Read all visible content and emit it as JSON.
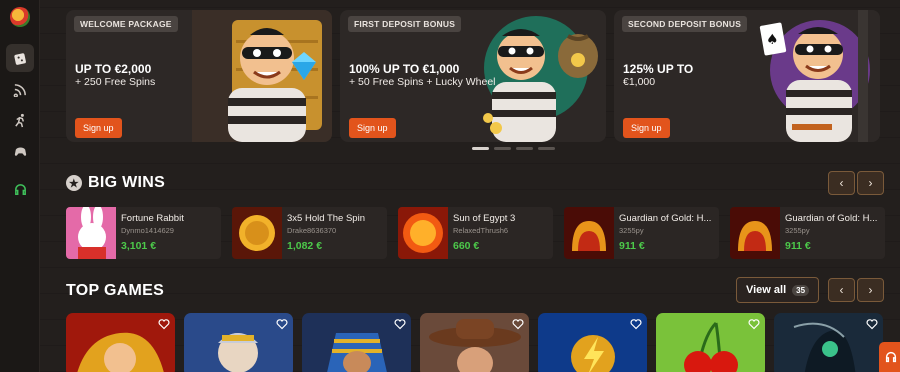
{
  "sidebar": {
    "items": [
      {
        "icon": "dice-icon",
        "active": true
      },
      {
        "icon": "live-icon",
        "active": false
      },
      {
        "icon": "sports-icon",
        "active": false
      },
      {
        "icon": "esports-icon",
        "active": false
      },
      {
        "icon": "headset-icon",
        "active": false
      }
    ]
  },
  "promos": [
    {
      "tag": "WELCOME PACKAGE",
      "headline": "UP TO €2,000",
      "sub": "+ 250 Free Spins",
      "cta": "Sign up"
    },
    {
      "tag": "FIRST DEPOSIT BONUS",
      "headline": "100% UP TO €1,000",
      "sub": "+ 50 Free Spins + Lucky Wheel",
      "cta": "Sign up"
    },
    {
      "tag": "SECOND DEPOSIT BONUS",
      "headline": "125% UP TO",
      "sub": "€1,000",
      "cta": "Sign up"
    }
  ],
  "carousel": {
    "slides": 4,
    "active": 0
  },
  "big_wins": {
    "title": "BIG WINS",
    "items": [
      {
        "game": "Fortune Rabbit",
        "user": "Dynmo1414629",
        "amount": "3,101 €"
      },
      {
        "game": "3x5 Hold The Spin",
        "user": "Drake8636370",
        "amount": "1,082 €"
      },
      {
        "game": "Sun of Egypt 3",
        "user": "RelaxedThrush6",
        "amount": "660 €"
      },
      {
        "game": "Guardian of Gold: H...",
        "user": "3255py",
        "amount": "911 €"
      },
      {
        "game": "Guardian of Gold: H...",
        "user": "3255py",
        "amount": "911 €"
      }
    ]
  },
  "top_games": {
    "title": "TOP GAMES",
    "view_all_label": "View all",
    "view_all_count": "35"
  },
  "colors": {
    "accent": "#e2541c",
    "win_green": "#4cc94a",
    "background": "#231f1d"
  }
}
